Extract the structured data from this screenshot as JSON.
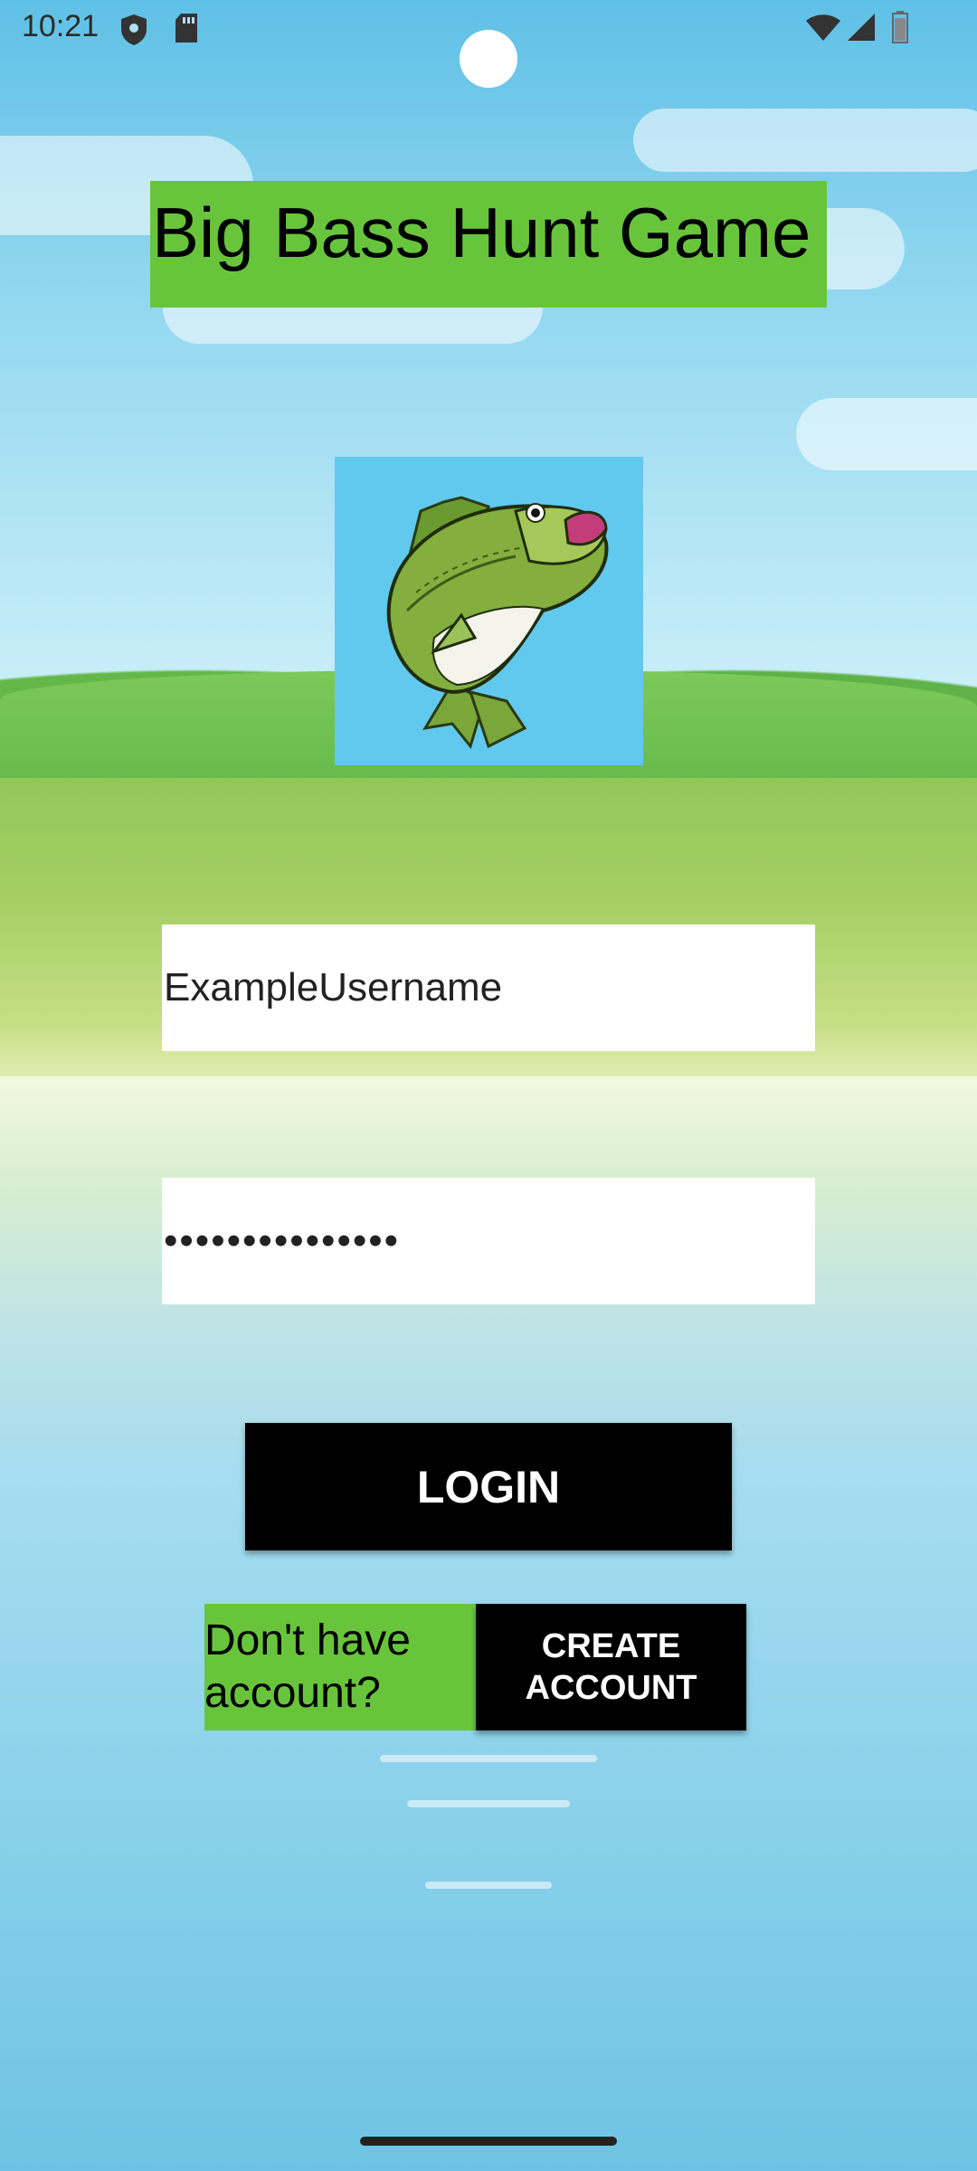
{
  "status_bar": {
    "time": "10:21",
    "icons": [
      "shield-icon",
      "sd-card-icon",
      "wifi-icon",
      "cell-signal-icon",
      "battery-icon"
    ]
  },
  "app": {
    "title": "Big Bass Hunt Game",
    "logo": "bass-fish-logo"
  },
  "login_form": {
    "username_value": "ExampleUsername",
    "password_masked": "•••••••••••••••",
    "login_label": "LOGIN"
  },
  "signup": {
    "prompt_line1": "Don't have",
    "prompt_line2": "account?",
    "button_line1": "CREATE",
    "button_line2": "ACCOUNT"
  },
  "colors": {
    "accent_green": "#68c53b",
    "button_black": "#000000",
    "logo_bg": "#62c9ee"
  }
}
